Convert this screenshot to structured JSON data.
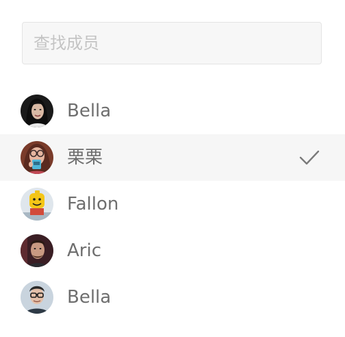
{
  "search": {
    "placeholder": "查找成员",
    "value": ""
  },
  "members": [
    {
      "name": "Bella",
      "avatar": "avatar-woman-dark-hair",
      "selected": false
    },
    {
      "name": "栗栗",
      "avatar": "avatar-woman-glasses-cup",
      "selected": true
    },
    {
      "name": "Fallon",
      "avatar": "avatar-lego-figure",
      "selected": false
    },
    {
      "name": "Aric",
      "avatar": "avatar-man-dark",
      "selected": false
    },
    {
      "name": "Bella",
      "avatar": "avatar-man-glasses",
      "selected": false
    }
  ],
  "icons": {
    "selected_indicator": "checkmark-icon"
  },
  "colors": {
    "selected_row_bg": "#f6f6f6",
    "name_text": "#6e6e6e",
    "placeholder_text": "#c4c4c4",
    "search_bg": "#f7f7f7",
    "checkmark": "#7a7a7a"
  }
}
